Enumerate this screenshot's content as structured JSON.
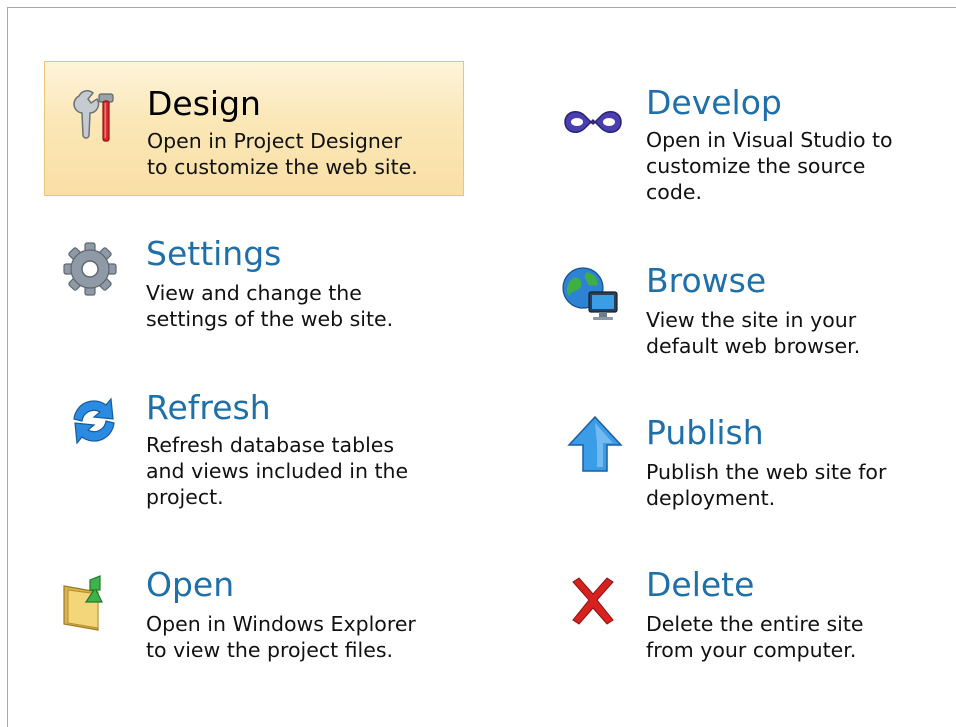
{
  "actions": {
    "design": {
      "title": "Design",
      "description": "Open in Project Designer\nto customize the web site.",
      "icon": "tools-icon",
      "selected": true
    },
    "settings": {
      "title": "Settings",
      "description": "View and change the\nsettings of the web site.",
      "icon": "gear-icon"
    },
    "refresh": {
      "title": "Refresh",
      "description": "Refresh database tables\nand views included in the\nproject.",
      "icon": "refresh-icon"
    },
    "open": {
      "title": "Open",
      "description": "Open in Windows Explorer\nto view the project files.",
      "icon": "folder-icon"
    },
    "develop": {
      "title": "Develop",
      "description": "Open in Visual Studio to\ncustomize the source\ncode.",
      "icon": "visual-studio-icon"
    },
    "browse": {
      "title": "Browse",
      "description": "View the site in your\ndefault web browser.",
      "icon": "globe-icon"
    },
    "publish": {
      "title": "Publish",
      "description": "Publish the web site for\ndeployment.",
      "icon": "up-arrow-icon"
    },
    "delete": {
      "title": "Delete",
      "description": "Delete the entire site\nfrom your computer.",
      "icon": "delete-icon"
    }
  },
  "colors": {
    "title": "#1f6fa8",
    "selected_title": "#000000",
    "selected_bg": "#fbe7b7",
    "selected_border": "#e5c67a",
    "delete_red": "#d6221f",
    "arrow_blue": "#2a8fe0"
  }
}
